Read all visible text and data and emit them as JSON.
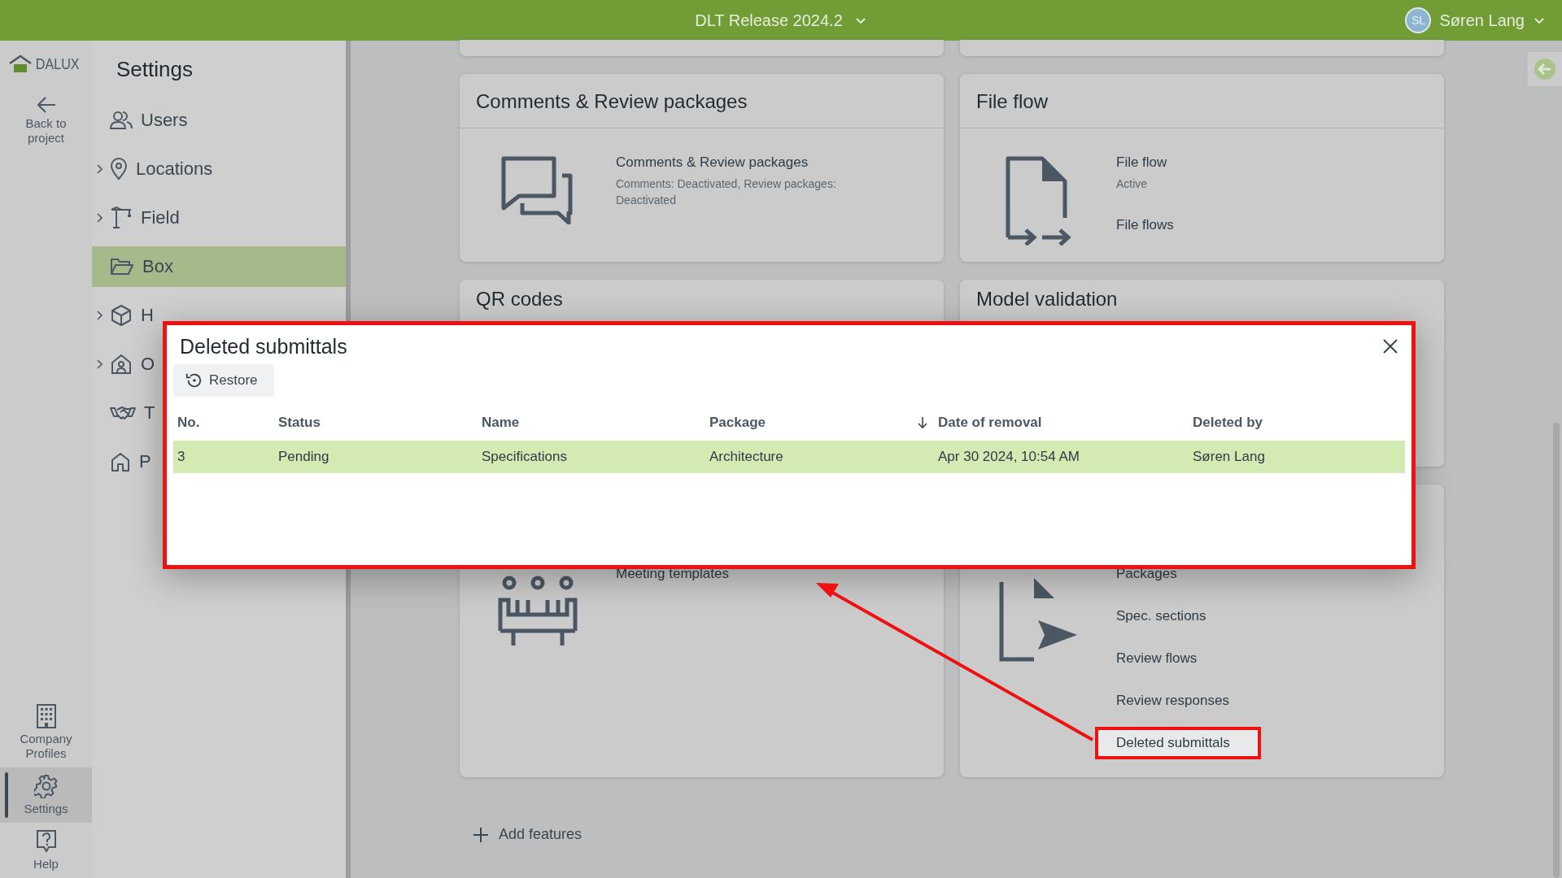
{
  "top_bar": {
    "project": "DLT Release 2024.2",
    "user": {
      "initials": "SL",
      "name": "Søren Lang"
    }
  },
  "rail": {
    "logo": "DALUX",
    "back": "Back to project",
    "items": [
      {
        "label": "Company Profiles",
        "kind": "company",
        "selected": false
      },
      {
        "label": "Settings",
        "kind": "settings",
        "selected": true
      },
      {
        "label": "Help",
        "kind": "help",
        "selected": false
      }
    ]
  },
  "settings_nav": {
    "title": "Settings",
    "items": [
      {
        "label": "Users",
        "kind": "users",
        "expandable": false,
        "selected": false
      },
      {
        "label": "Locations",
        "kind": "pin",
        "expandable": true,
        "selected": false
      },
      {
        "label": "Field",
        "kind": "crane",
        "expandable": true,
        "selected": false
      },
      {
        "label": "Box",
        "kind": "folder",
        "expandable": false,
        "selected": true
      },
      {
        "label": "H",
        "kind": "cube",
        "expandable": true,
        "selected": false
      },
      {
        "label": "O",
        "kind": "house-person",
        "expandable": true,
        "selected": false
      },
      {
        "label": "T",
        "kind": "handshake",
        "expandable": false,
        "selected": false
      },
      {
        "label": "P",
        "kind": "house",
        "expandable": false,
        "selected": false
      }
    ]
  },
  "cards": [
    {
      "title": "Comments & Review packages",
      "kind": "comments",
      "entries": [
        {
          "title": "Comments & Review packages",
          "subtitle": "Comments: Deactivated, Review packages: Deactivated",
          "selected": false
        }
      ]
    },
    {
      "title": "File flow",
      "kind": "fileflow",
      "entries": [
        {
          "title": "File flow",
          "subtitle": "Active",
          "selected": false
        },
        {
          "title": "File flows",
          "selected": false
        }
      ]
    },
    {
      "title": "QR codes",
      "kind": "plain"
    },
    {
      "title": "Model validation",
      "kind": "plain"
    },
    {
      "kind": "meetings",
      "entries": [
        {
          "title": "Meeting templates",
          "selected": false
        }
      ]
    },
    {
      "kind": "submittals",
      "entries": [
        {
          "title": "Packages",
          "selected": false
        },
        {
          "title": "Spec. sections",
          "selected": false
        },
        {
          "title": "Review flows",
          "selected": false
        },
        {
          "title": "Review responses",
          "selected": false
        },
        {
          "title": "Deleted submittals",
          "selected": true
        }
      ]
    }
  ],
  "add_features": "Add features",
  "dialog": {
    "title": "Deleted submittals",
    "restore": "Restore",
    "columns": [
      {
        "label": "No.",
        "sorted": false
      },
      {
        "label": "Status",
        "sorted": false
      },
      {
        "label": "Name",
        "sorted": false
      },
      {
        "label": "Package",
        "sorted": false
      },
      {
        "label": "Date of removal",
        "sorted": true
      },
      {
        "label": "Deleted by",
        "sorted": false
      }
    ],
    "rows": [
      {
        "selected": true,
        "cells": [
          "3",
          "Pending",
          "Specifications",
          "Architecture",
          "Apr 30 2024, 10:54 AM",
          "Søren Lang"
        ]
      }
    ]
  }
}
